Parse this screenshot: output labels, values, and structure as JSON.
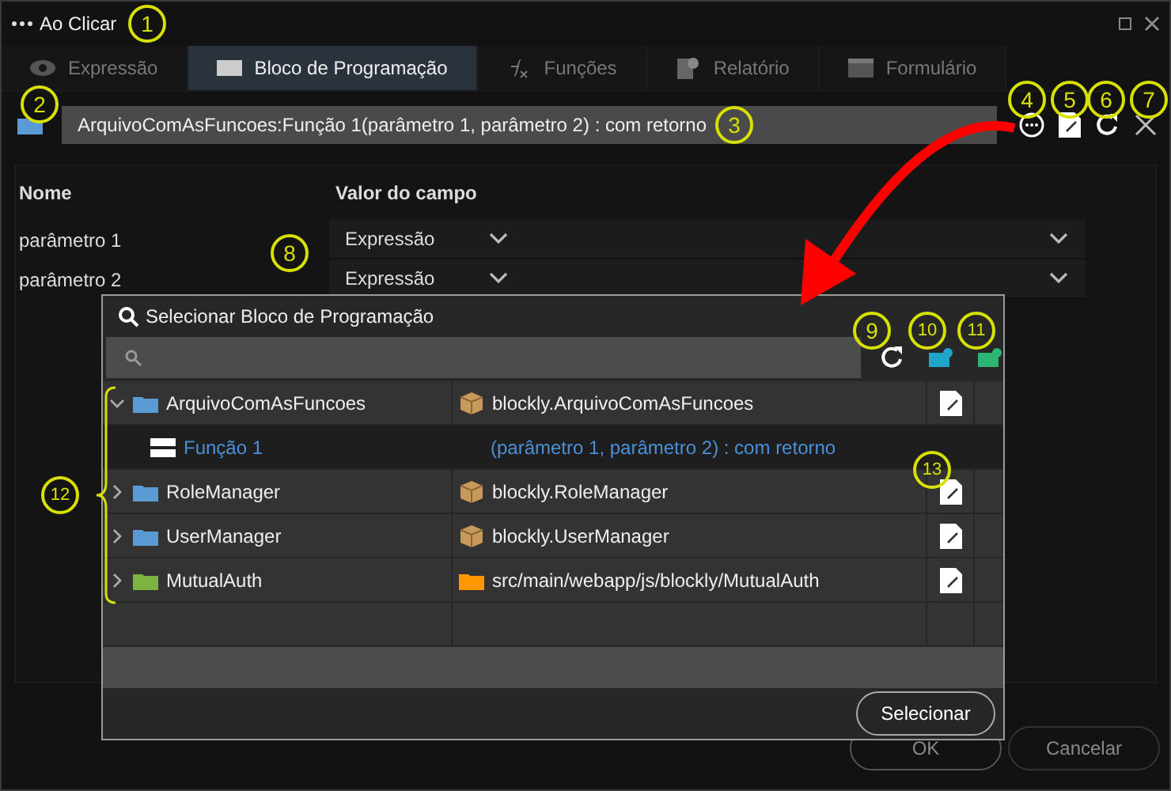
{
  "window": {
    "title": "Ao Clicar"
  },
  "tabs": [
    {
      "label": "Expressão",
      "selected": false,
      "kind": "eye"
    },
    {
      "label": "Bloco de Programação",
      "selected": true,
      "kind": "block"
    },
    {
      "label": "Funções",
      "selected": false,
      "kind": "fx"
    },
    {
      "label": "Relatório",
      "selected": false,
      "kind": "report"
    },
    {
      "label": "Formulário",
      "selected": false,
      "kind": "form"
    }
  ],
  "expression": {
    "value": "ArquivoComAsFuncoes:Função 1(parâmetro 1, parâmetro 2) : com retorno"
  },
  "params_table": {
    "columns": [
      "Nome",
      "Valor do campo"
    ],
    "rows": [
      {
        "name": "parâmetro 1",
        "value": "Expressão"
      },
      {
        "name": "parâmetro 2",
        "value": "Expressão"
      }
    ]
  },
  "modal": {
    "title": "Selecionar Bloco de Programação",
    "rows": [
      {
        "name": "ArquivoComAsFuncoes",
        "location": "blockly.ArquivoComAsFuncoes",
        "kind": "package",
        "color": "#5b9bd5",
        "expanded": true,
        "selected": false,
        "children": [
          {
            "name": "Função 1",
            "location": "(parâmetro 1, parâmetro 2) : com retorno",
            "selected": true
          }
        ]
      },
      {
        "name": "RoleManager",
        "location": "blockly.RoleManager",
        "kind": "package",
        "color": "#5b9bd5",
        "expanded": false,
        "selected": false
      },
      {
        "name": "UserManager",
        "location": "blockly.UserManager",
        "kind": "package",
        "color": "#5b9bd5",
        "expanded": false,
        "selected": false
      },
      {
        "name": "MutualAuth",
        "location": "src/main/webapp/js/blockly/MutualAuth",
        "kind": "folder",
        "color": "#7cb342",
        "expanded": false,
        "selected": false
      }
    ],
    "button": "Selecionar"
  },
  "buttons": [
    "OK",
    "Cancelar"
  ],
  "callouts": [
    "1",
    "2",
    "3",
    "4",
    "5",
    "6",
    "7",
    "8",
    "9",
    "10",
    "11",
    "12",
    "13"
  ]
}
